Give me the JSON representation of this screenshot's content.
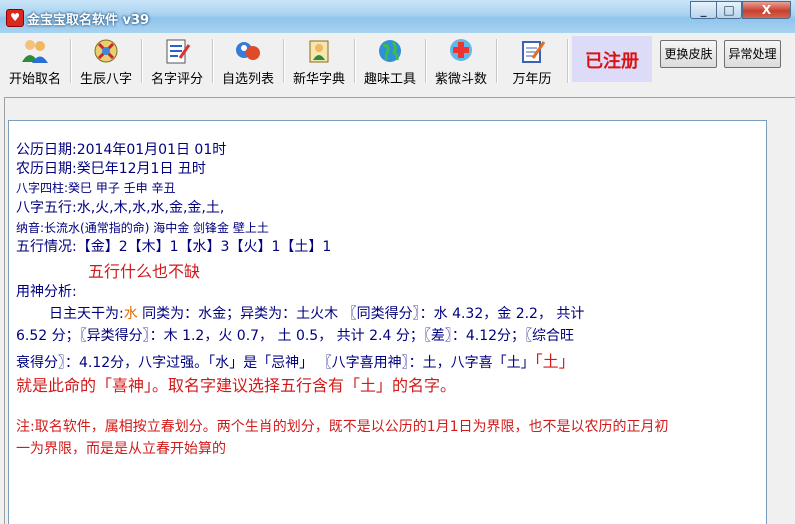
{
  "window": {
    "title": "金宝宝取名软件 v39",
    "min": "_",
    "max": "□",
    "close": "X"
  },
  "toolbar": {
    "items": [
      {
        "label": "开始取名",
        "icon": "people-icon"
      },
      {
        "label": "生辰八字",
        "icon": "bagua-person-icon"
      },
      {
        "label": "名字评分",
        "icon": "scorecard-icon"
      },
      {
        "label": "自选列表",
        "icon": "list-icon"
      },
      {
        "label": "新华字典",
        "icon": "dictionary-icon"
      },
      {
        "label": "趣味工具",
        "icon": "globe-icon"
      },
      {
        "label": "紫微斗数",
        "icon": "health-icon"
      },
      {
        "label": "万年历",
        "icon": "calendar-icon"
      }
    ],
    "registered": "已注册",
    "change_skin": "更换皮肤",
    "exception": "异常处理"
  },
  "content": {
    "solar_date": "公历日期:2014年01月01日 01时",
    "lunar_date": "农历日期:癸巳年12月1日 丑时",
    "bazi": "八字四柱:癸巳 甲子 壬申 辛丑",
    "wuxing": "八字五行:水,火,木,水,水,金,金,土,",
    "nayin": "纳音:长流水(通常指的命)  海中金 剑锋金 壁上土",
    "wuxing_status": "五行情况:【金】2【木】1【水】3【火】1【土】1",
    "complete": "五行什么也不缺",
    "xishen_title": "用神分析:",
    "analysis_prefix": "日主天干为:",
    "analysis_element": "水",
    "analysis_line1_rest": "  同类为：水金；异类为：土火木 〖同类得分〗：水 4.32，金 2.2，  共计",
    "analysis_line2": "6.52 分；〖异类得分〗：木 1.2，火 0.7，  土 0.5，  共计 2.4 分；〖差〗：4.12分；〖综合旺",
    "analysis_line3": "衰得分〗：4.12分，八字过强。「水」是「忌神」   〖八字喜用神〗：土，八字喜「土」",
    "analysis_line3_red": "「土」",
    "conclusion": "就是此命的「喜神」。取名字建议选择五行含有「土」的名字。",
    "note1": "注:取名软件，属相按立春划分。两个生肖的划分，既不是以公历的1月1日为界限，也不是以农历的正月初",
    "note2": "一为界限，而是是从立春开始算的"
  },
  "colors": {
    "accent": "#000080",
    "warning": "#d11a1a",
    "element": "#e07000"
  }
}
